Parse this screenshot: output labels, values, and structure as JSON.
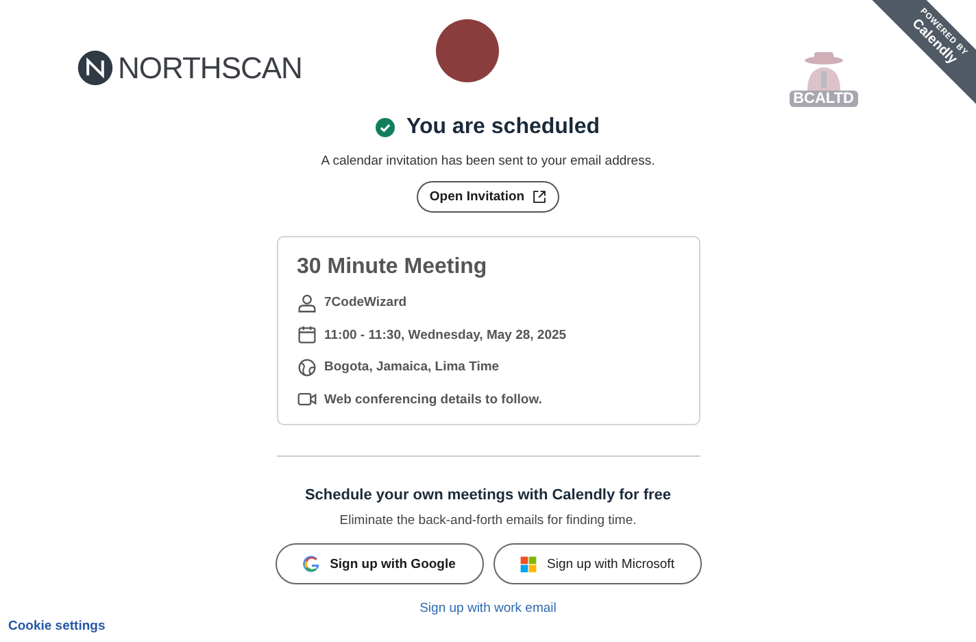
{
  "header": {
    "logo_text": "NORTHSCAN",
    "partner_logo_text": "BCALTD",
    "ribbon": {
      "line_1": "POWERED BY",
      "line_2": "Calendly"
    }
  },
  "confirmation": {
    "title": "You are scheduled",
    "message": "A calendar invitation has been sent to your email address.",
    "open_button": "Open Invitation"
  },
  "event": {
    "title": "30 Minute Meeting",
    "details": [
      {
        "kind": "person",
        "text": "7CodeWizard"
      },
      {
        "kind": "calendar",
        "text": "11:00 - 11:30, Wednesday, May 28, 2025"
      },
      {
        "kind": "globe",
        "text": "Bogota, Jamaica, Lima Time"
      },
      {
        "kind": "video",
        "text": "Web conferencing details to follow."
      }
    ]
  },
  "promo": {
    "headline": "Schedule your own meetings with Calendly for free",
    "subtext": "Eliminate the back-and-forth emails for finding time.",
    "buttons": [
      {
        "kind": "google",
        "label": "Sign up with Google"
      },
      {
        "kind": "microsoft",
        "label": "Sign up with Microsoft"
      }
    ],
    "email_link": "Sign up with work email"
  },
  "footer": {
    "cookie_link": "Cookie settings"
  }
}
